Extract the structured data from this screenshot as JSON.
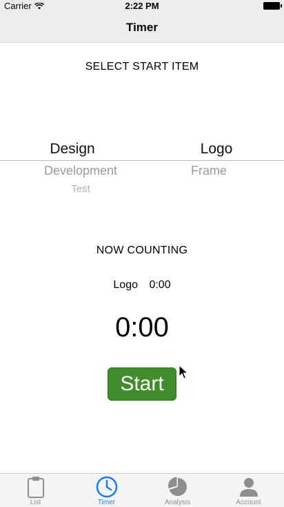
{
  "status_bar": {
    "carrier": "Carrier",
    "time": "2:22 PM"
  },
  "nav": {
    "title": "Timer"
  },
  "select_label": "SELECT START ITEM",
  "picker": {
    "left_column": {
      "selected": "Design",
      "next1": "Development",
      "next2": "Test"
    },
    "right_column": {
      "selected": "Logo",
      "next1": "Frame"
    }
  },
  "now_counting_label": "NOW COUNTING",
  "counting": {
    "item": "Logo",
    "elapsed": "0:00"
  },
  "big_timer": "0:00",
  "start_button_label": "Start",
  "tabs": [
    {
      "label": "List",
      "icon": "clipboard-icon",
      "active": false
    },
    {
      "label": "Timer",
      "icon": "clock-icon",
      "active": true
    },
    {
      "label": "Analysis",
      "icon": "pie-chart-icon",
      "active": false
    },
    {
      "label": "Account",
      "icon": "person-icon",
      "active": false
    }
  ],
  "colors": {
    "accent": "#1a7cf5",
    "start_button": "#3f8d2c",
    "bar_background": "#ececec"
  }
}
